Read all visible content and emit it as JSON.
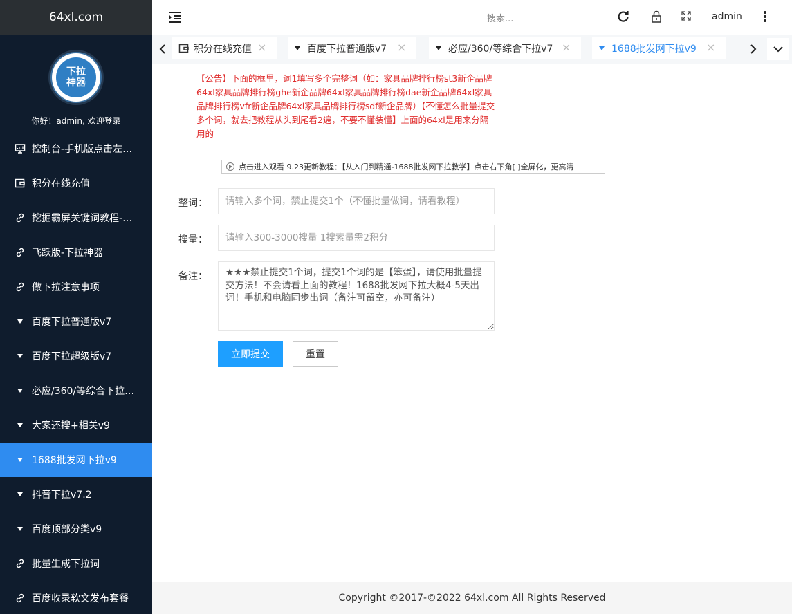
{
  "brand": "64xl.com",
  "profile": {
    "logo_text_top": "下拉",
    "logo_text_bottom": "神器",
    "welcome": "你好！admin, 欢迎登录"
  },
  "sidebar": {
    "items": [
      {
        "label": "控制台-手机版点击左上角",
        "icon": "monitor-icon"
      },
      {
        "label": "积分在线充值",
        "icon": "wallet-icon"
      },
      {
        "label": "挖掘霸屏关键词教程-必看",
        "icon": "link-icon"
      },
      {
        "label": "飞跃版-下拉神器",
        "icon": "link-icon"
      },
      {
        "label": "做下拉注意事项",
        "icon": "link-icon"
      },
      {
        "label": "百度下拉普通版v7",
        "icon": "triangle-down-icon"
      },
      {
        "label": "百度下拉超级版v7",
        "icon": "triangle-down-icon"
      },
      {
        "label": "必应/360/等综合下拉v7",
        "icon": "triangle-down-icon"
      },
      {
        "label": "大家还搜+相关v9",
        "icon": "triangle-down-icon"
      },
      {
        "label": "1688批发网下拉v9",
        "icon": "triangle-down-icon",
        "active": true
      },
      {
        "label": "抖音下拉v7.2",
        "icon": "triangle-down-icon"
      },
      {
        "label": "百度顶部分类v9",
        "icon": "triangle-down-icon"
      },
      {
        "label": "批量生成下拉词",
        "icon": "link-icon"
      },
      {
        "label": "百度收录软文发布套餐",
        "icon": "link-icon"
      }
    ]
  },
  "header": {
    "search_placeholder": "搜索...",
    "user": "admin"
  },
  "tabs": [
    {
      "label": "积分在线充值",
      "icon": "wallet-icon"
    },
    {
      "label": "百度下拉普通版v7",
      "icon": "triangle-down-icon"
    },
    {
      "label": "必应/360/等综合下拉v7",
      "icon": "triangle-down-icon"
    },
    {
      "label": "1688批发网下拉v9",
      "icon": "triangle-down-icon",
      "active": true
    }
  ],
  "main": {
    "notice": "【公告】下面的框里，词1填写多个完整词（如：家具品牌排行榜st3新企品牌64xl家具品牌排行榜ghe新企品牌64xl家具品牌排行榜dae新企品牌64xl家具品牌排行榜vfr新企品牌64xl家具品牌排行榜sdf新企品牌）【不懂怎么批量提交多个词，就去把教程从头到尾看2遍，不要不懂装懂】上面的64xl是用来分隔用的",
    "video_link": "点击进入观看 9.23更新教程：【从入门到精通-1688批发网下拉教学】点击右下角[ ]全屏化，更高清",
    "form": {
      "keyword_label": "整词：",
      "keyword_placeholder": "请输入多个词，禁止提交1个（不懂批量做词，请看教程）",
      "volume_label": "搜量：",
      "volume_placeholder": "请输入300-3000搜量 1搜索量需2积分",
      "note_label": "备注：",
      "note_value": "★★★禁止提交1个词，提交1个词的是【笨蛋】，请使用批量提交方法！不会请看上面的教程！1688批发网下拉大概4-5天出词！手机和电脑同步出词（备注可留空，亦可备注）",
      "submit_label": "立即提交",
      "reset_label": "重置"
    }
  },
  "footer": "Copyright ©2017-©2022 64xl.com All Rights Reserved",
  "colors": {
    "sidebar_bg": "#0f1c2d",
    "active": "#2f8cf0",
    "notice": "#e02d2d",
    "submit": "#1e9fff"
  }
}
